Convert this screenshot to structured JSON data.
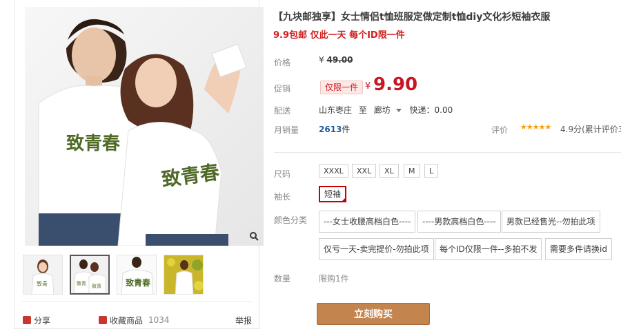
{
  "product": {
    "title": "【九块邮独享】女士情侣t恤班服定做定制t恤diy文化衫短袖衣服",
    "subtitle": "9.9包邮 仅此一天 每个ID限一件"
  },
  "price": {
    "label": "价格",
    "currency": "¥",
    "original": "49.00"
  },
  "promo": {
    "label": "促销",
    "tag": "仅限一件",
    "currency": "¥",
    "price": "9.90"
  },
  "shipping": {
    "label": "配送",
    "from": "山东枣庄",
    "to_word": "至",
    "dest": "廊坊",
    "express": "快递：0.00"
  },
  "sales": {
    "label": "月销量",
    "count": "2613",
    "unit": "件",
    "rating_label": "评价",
    "stars": "★★★★★",
    "rating_text": "4.9分(累计评价3"
  },
  "size": {
    "label": "尺码",
    "options": [
      "XXXL",
      "XXL",
      "XL",
      "M",
      "L"
    ]
  },
  "sleeve": {
    "label": "袖长",
    "options": [
      "短袖"
    ],
    "selected": "短袖"
  },
  "color": {
    "label": "颜色分类",
    "options": [
      "---女士收腰高档白色----",
      "----男款高档白色----",
      "男款已经售光--勿拍此项",
      "仅亏一天-卖完提价-勿拍此项",
      "每个ID仅限一件--多拍不发",
      "需要多件请换id"
    ]
  },
  "quantity": {
    "label": "数量",
    "value": "限购1件"
  },
  "buy_button": "立刻购买",
  "gallery": {
    "shirt_text": "致青春",
    "shirt_subtext": "我们终将逝去的",
    "shirt_brand": "So Young"
  },
  "share": {
    "share_label": "分享",
    "favorite_label": "收藏商品",
    "favorite_count": "1034",
    "report_label": "举报"
  },
  "colors": {
    "accent_red": "#c81623",
    "buy_button": "#c4844d",
    "link_blue": "#1a5a9a",
    "star_orange": "#ff9a00"
  }
}
